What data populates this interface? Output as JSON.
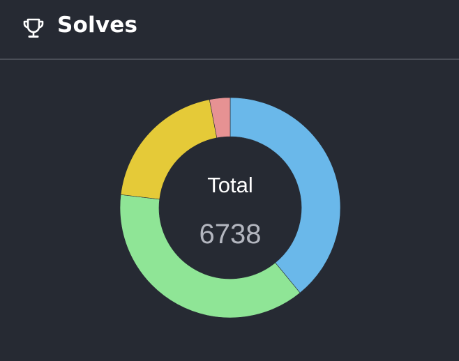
{
  "header": {
    "title": "Solves",
    "icon": "trophy-icon"
  },
  "center": {
    "label": "Total",
    "value": "6738"
  },
  "chart_data": {
    "type": "pie",
    "donut": true,
    "title": "",
    "categories": [
      "",
      "",
      "",
      ""
    ],
    "values": [
      2633,
      2548,
      1354,
      203
    ],
    "colors": [
      "#6ab8ea",
      "#8fe596",
      "#e5ca38",
      "#e69293"
    ],
    "total": 6738
  }
}
